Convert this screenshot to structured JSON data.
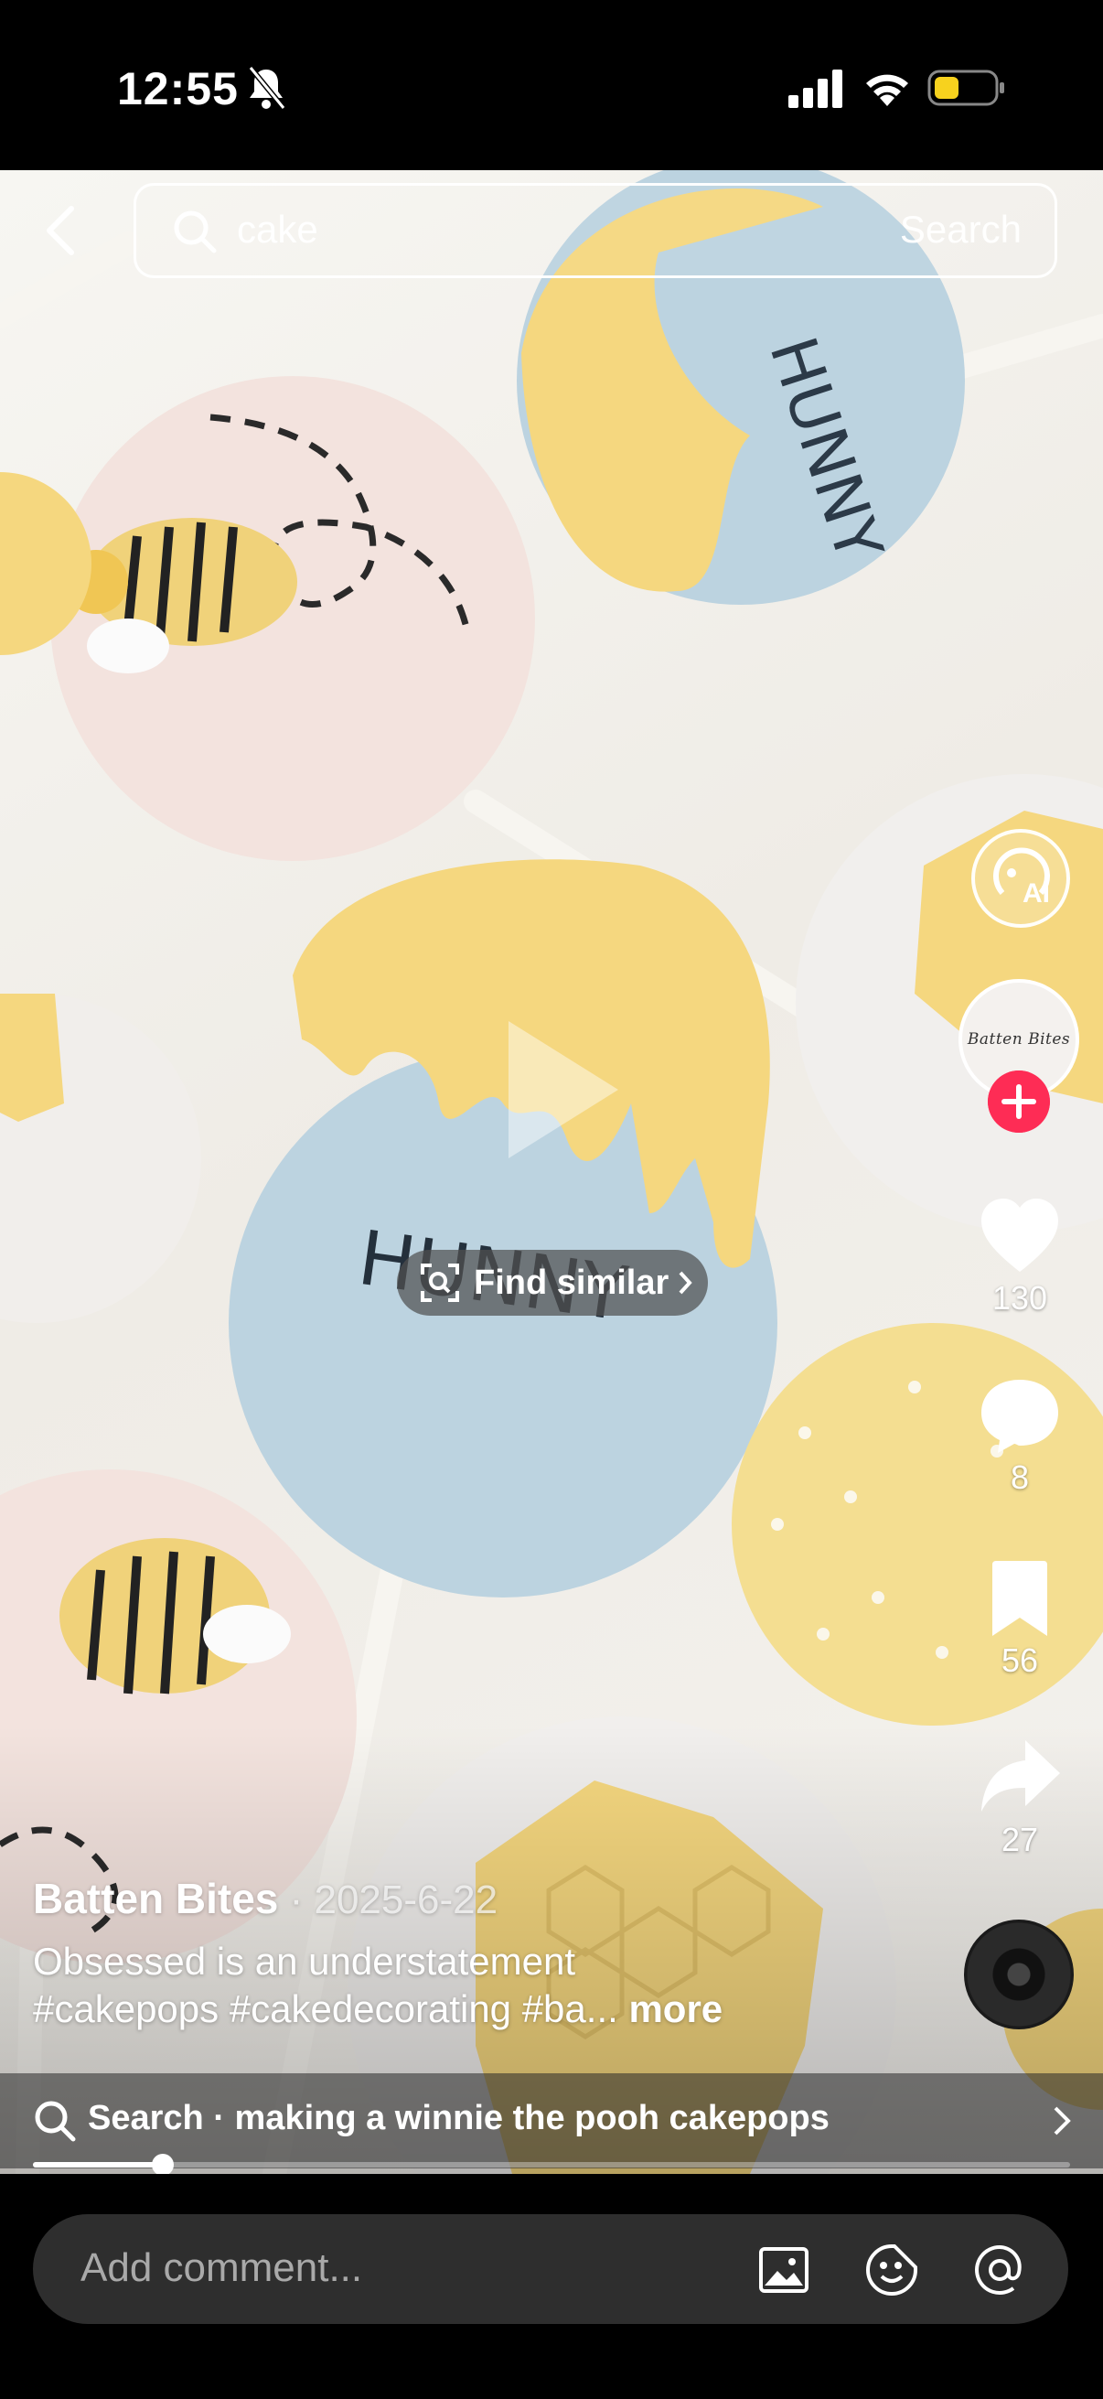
{
  "status_bar": {
    "time": "12:55"
  },
  "search": {
    "query": "cake",
    "button_label": "Search"
  },
  "video": {
    "overlay_text": "HUNNY"
  },
  "find_similar": {
    "label": "Find similar"
  },
  "rail": {
    "avatar_text": "Batten Bites",
    "likes": "130",
    "comments": "8",
    "saves": "56",
    "shares": "27"
  },
  "caption": {
    "author": "Batten Bites",
    "date": " · 2025-6-22",
    "line1": "Obsessed is an understatement",
    "line2": "#cakepops #cakedecorating #ba...",
    "more": " more"
  },
  "suggestion": {
    "text": "Search · making a winnie the pooh cakepops"
  },
  "progress": {
    "fraction": 0.125
  },
  "comment": {
    "placeholder": "Add comment..."
  },
  "colors": {
    "accent": "#fe2c55",
    "yellow": "#f5d77f",
    "blue": "#bcd3e0",
    "pink": "#f3e3de"
  }
}
